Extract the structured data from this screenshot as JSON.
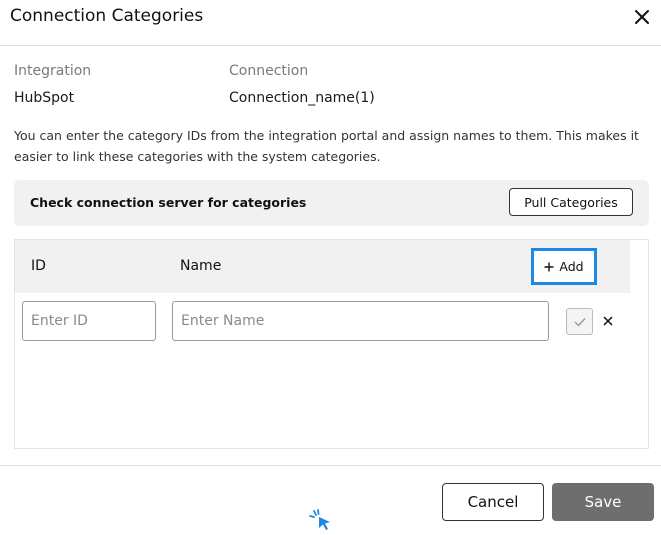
{
  "dialog": {
    "title": "Connection Categories",
    "close_icon": "close-icon"
  },
  "meta": {
    "integration_label": "Integration",
    "integration_value": "HubSpot",
    "connection_label": "Connection",
    "connection_value": "Connection_name(1)"
  },
  "description": "You can enter the category IDs from the integration portal and assign names to them. This makes it easier to link these categories with the system categories.",
  "check_panel": {
    "text": "Check connection server for categories",
    "pull_button": "Pull Categories"
  },
  "table": {
    "columns": [
      "ID",
      "Name"
    ],
    "add_button": "Add",
    "add_icon": "plus-icon",
    "row": {
      "id_placeholder": "Enter ID",
      "name_placeholder": "Enter Name",
      "confirm_icon": "check-icon",
      "remove_icon": "close-icon"
    }
  },
  "footer": {
    "cancel_button": "Cancel",
    "save_button": "Save"
  },
  "colors": {
    "accent": "#1e88e5",
    "save_bg": "#6e6e6e",
    "panel_bg": "#f1f1f1"
  }
}
